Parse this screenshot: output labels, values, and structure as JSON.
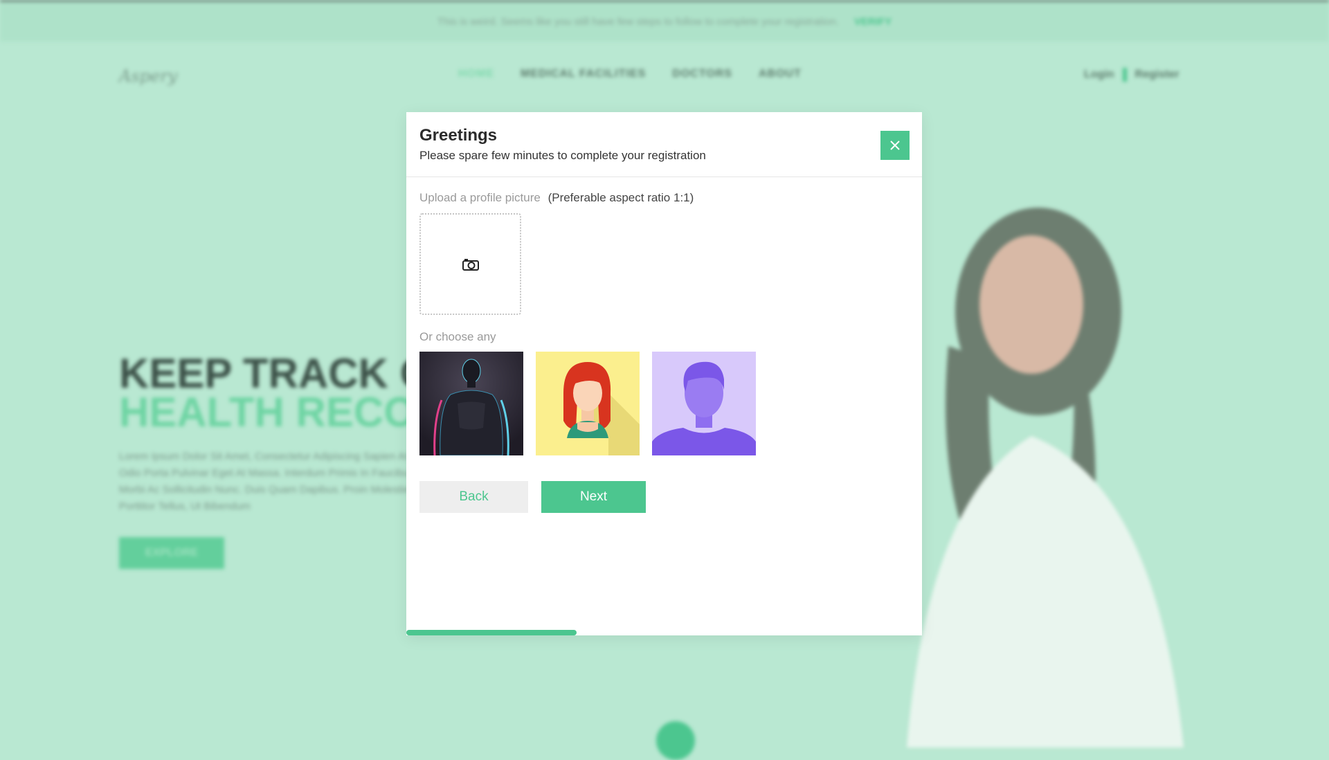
{
  "background": {
    "notice": "This is weird. Seems like you still have few steps to follow to complete your registration.",
    "notice_link": "VERIFY",
    "logo": "Aspery",
    "menu": [
      "HOME",
      "MEDICAL FACILITIES",
      "DOCTORS",
      "ABOUT"
    ],
    "login": "Login",
    "register": "Register",
    "hero_line1": "KEEP TRACK OF",
    "hero_line2": "HEALTH RECORDS",
    "hero_text": "Lorem Ipsum Dolor Sit Amet, Consectetur Adipiscing Sapien At Odio Porta Pulvinar Eget At Massa. Interdum Primis In Faucibus. Morbi Ac Sollicitudin Nunc. Duis Quam Dapibus. Proin Molestie Porttitor Tellus, Ut Bibendum",
    "explore": "EXPLORE"
  },
  "modal": {
    "title": "Greetings",
    "subtitle": "Please spare few minutes to complete your registration",
    "upload_label": "Upload a profile picture",
    "upload_hint": "(Preferable aspect ratio 1:1)",
    "choose_label": "Or choose any",
    "back_label": "Back",
    "next_label": "Next",
    "progress": 0.33
  },
  "colors": {
    "accent": "#4cc68f",
    "overlay": "#b9e8d2"
  },
  "icons": {
    "close": "close-icon",
    "upload": "camera-icon"
  }
}
